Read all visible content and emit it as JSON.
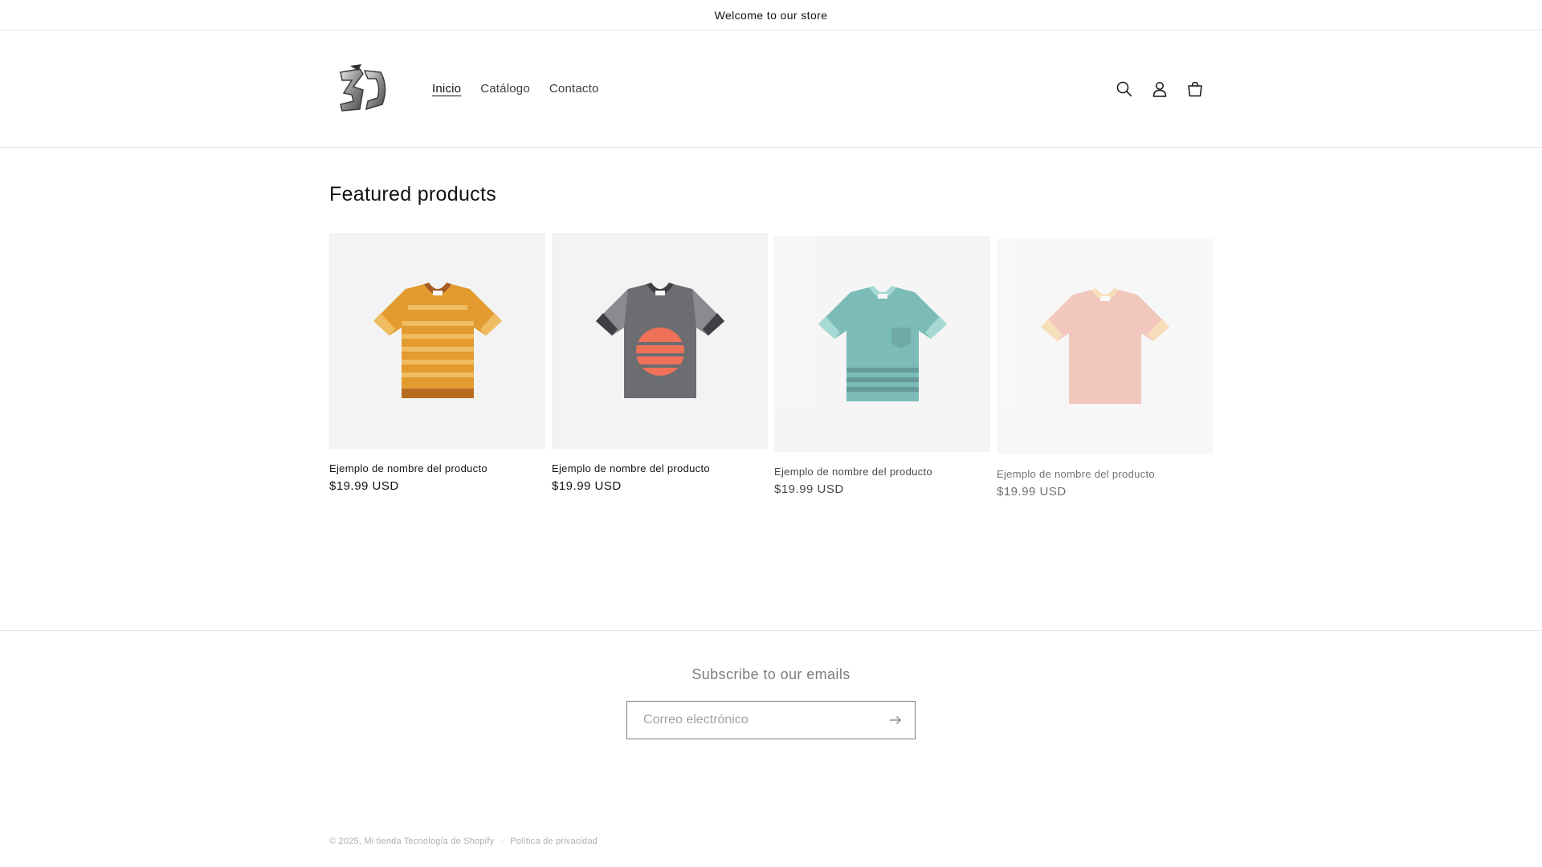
{
  "announcement": {
    "text": "Welcome to our store"
  },
  "header": {
    "logo_text": "3D",
    "nav": [
      {
        "label": "Inicio",
        "active": true
      },
      {
        "label": "Catálogo",
        "active": false
      },
      {
        "label": "Contacto",
        "active": false
      }
    ],
    "icons": [
      "search-icon",
      "account-icon",
      "cart-icon"
    ]
  },
  "featured": {
    "title": "Featured products",
    "products": [
      {
        "name": "Ejemplo de nombre del producto",
        "price": "$19.99 USD",
        "shirt_color": "#e39a2f",
        "accent_color": "#a75b25"
      },
      {
        "name": "Ejemplo de nombre del producto",
        "price": "$19.99 USD",
        "shirt_color": "#6c6d70",
        "accent_color": "#ee7158"
      },
      {
        "name": "Ejemplo de nombre del producto",
        "price": "$19.99 USD",
        "shirt_color": "#57aaa5",
        "accent_color": "#3a807c"
      },
      {
        "name": "Ejemplo de nombre del producto",
        "price": "$19.99 USD",
        "shirt_color": "#eaa393",
        "accent_color": "#f3c98d"
      }
    ]
  },
  "newsletter": {
    "title": "Subscribe to our emails",
    "email_placeholder": "Correo electrónico"
  },
  "footer": {
    "copyright": "© 2025, Mi tienda Tecnología de Shopify",
    "separator": "·",
    "privacy_link": "Política de privacidad"
  }
}
